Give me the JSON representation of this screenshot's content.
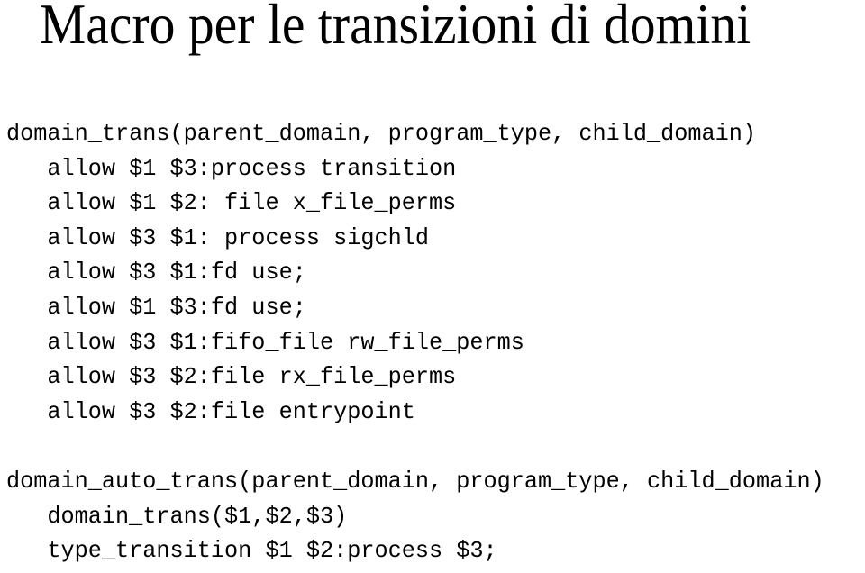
{
  "slide": {
    "title": "Macro per le transizioni di domini",
    "background_color": "#ffffff",
    "text_color": "#000000"
  },
  "code": {
    "blocks": [
      {
        "name": "domain_trans-macro",
        "lines": [
          "domain_trans(parent_domain, program_type, child_domain)",
          "   allow $1 $3:process transition",
          "   allow $1 $2: file x_file_perms",
          "   allow $3 $1: process sigchld",
          "   allow $3 $1:fd use;",
          "   allow $1 $3:fd use;",
          "   allow $3 $1:fifo_file rw_file_perms",
          "   allow $3 $2:file rx_file_perms",
          "   allow $3 $2:file entrypoint"
        ]
      },
      {
        "name": "spacer",
        "lines": [
          ""
        ]
      },
      {
        "name": "domain_auto_trans-macro",
        "lines": [
          "domain_auto_trans(parent_domain, program_type, child_domain)",
          "   domain_trans($1,$2,$3)",
          "   type_transition $1 $2:process $3;"
        ]
      }
    ]
  }
}
